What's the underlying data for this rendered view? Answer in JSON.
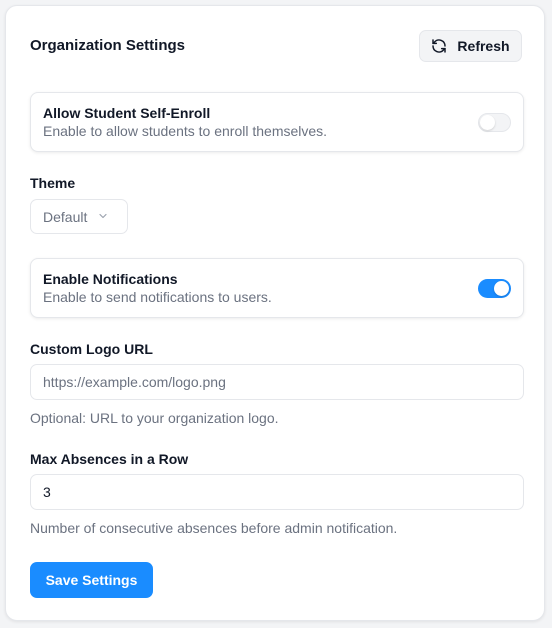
{
  "header": {
    "title": "Organization Settings",
    "refresh_label": "Refresh",
    "refresh_icon": "refresh-icon"
  },
  "self_enroll": {
    "title": "Allow Student Self-Enroll",
    "description": "Enable to allow students to enroll themselves.",
    "enabled": false
  },
  "theme": {
    "label": "Theme",
    "selected": "Default",
    "icon": "chevron-down-icon"
  },
  "notifications": {
    "title": "Enable Notifications",
    "description": "Enable to send notifications to users.",
    "enabled": true
  },
  "logo_url": {
    "label": "Custom Logo URL",
    "value": "",
    "placeholder": "https://example.com/logo.png",
    "hint": "Optional: URL to your organization logo."
  },
  "max_absences": {
    "label": "Max Absences in a Row",
    "value": "3",
    "hint": "Number of consecutive absences before admin notification."
  },
  "actions": {
    "save_label": "Save Settings"
  },
  "colors": {
    "accent": "#1a8cff",
    "muted_text": "#6b7280",
    "border": "#e5e7eb"
  }
}
